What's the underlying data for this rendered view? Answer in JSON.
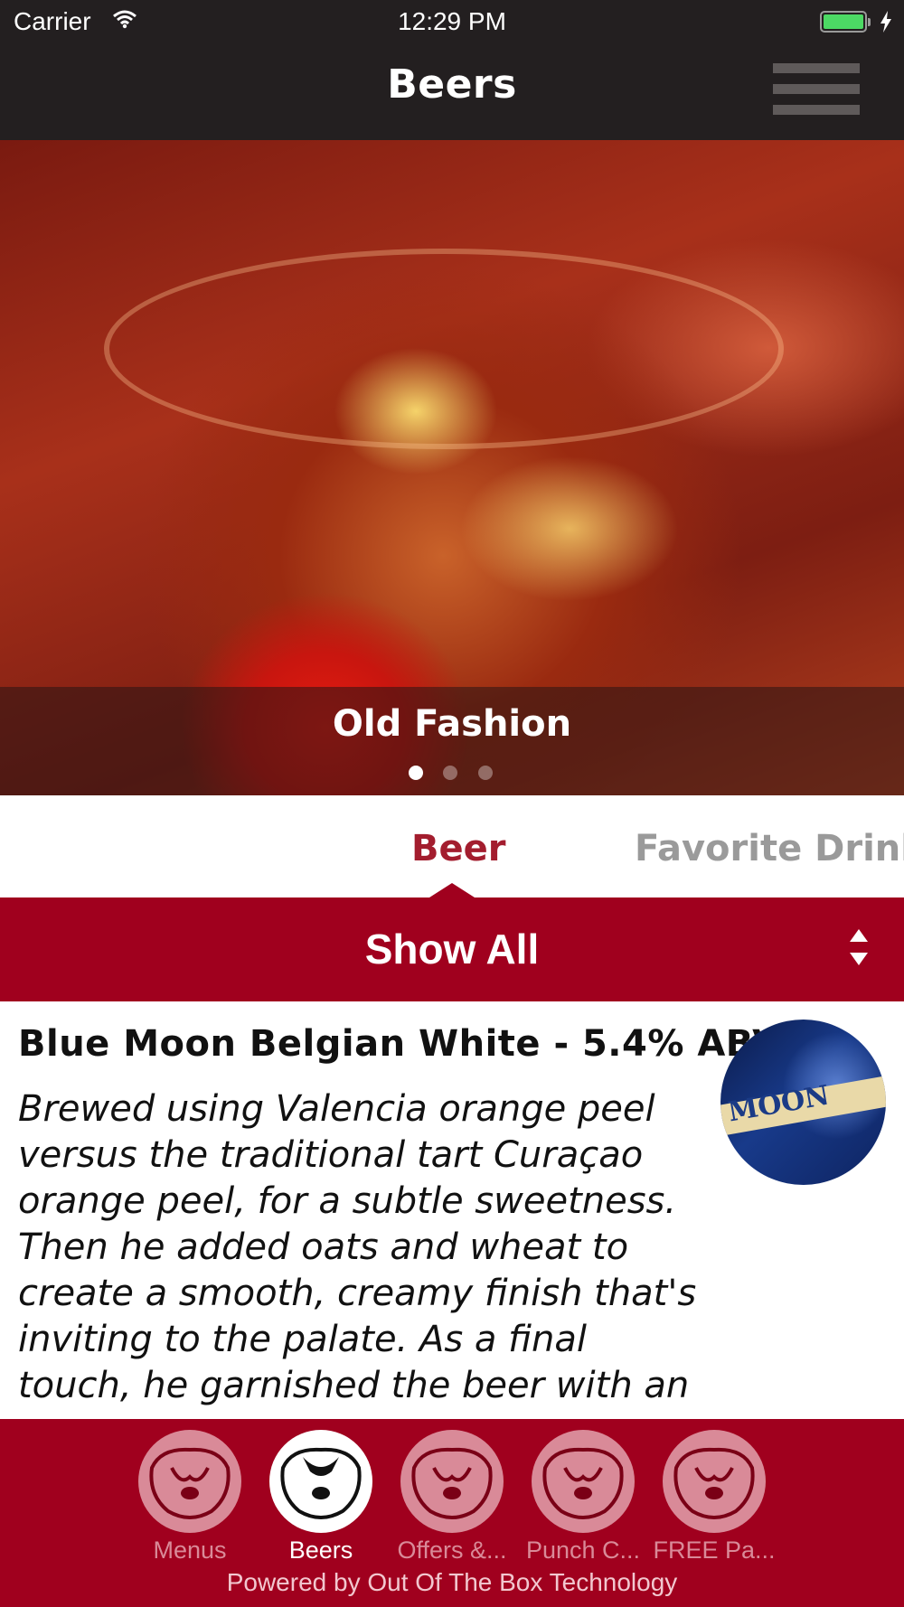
{
  "status_bar": {
    "carrier": "Carrier",
    "time": "12:29 PM",
    "battery_level": 1.0,
    "wifi_icon": "wifi-icon",
    "charging_icon": "bolt-icon"
  },
  "nav": {
    "title": "Beers",
    "menu_icon": "hamburger-icon"
  },
  "hero": {
    "caption": "Old Fashion",
    "page_count": 3,
    "current_page": 1
  },
  "tabs": [
    {
      "label": "Beer",
      "selected": true
    },
    {
      "label": "Favorite Drink",
      "selected": false
    }
  ],
  "filter": {
    "label": "Show All",
    "icon": "sort-updown-icon"
  },
  "items": [
    {
      "title": "Blue Moon Belgian White - 5.4% ABV",
      "description": "Brewed using Valencia orange peel versus the traditional tart Curaçao orange peel, for a subtle sweetness. Then he added oats and wheat to create a smooth, creamy finish that's inviting to the palate. As a final touch, he garnished the beer with an",
      "thumbnail_text": "MOON"
    }
  ],
  "tabbar": {
    "items": [
      {
        "label": "Menus",
        "active": false
      },
      {
        "label": "Beers",
        "active": true
      },
      {
        "label": "Offers &...",
        "active": false
      },
      {
        "label": "Punch C...",
        "active": false
      },
      {
        "label": "FREE Pa...",
        "active": false
      }
    ],
    "footer": "Powered by Out Of The Box Technology"
  },
  "colors": {
    "nav_bg": "#231f20",
    "accent": "#a0001e",
    "tab_selected": "#a31d2e",
    "tab_unselected": "#9a9a9a",
    "tab_icon_inactive": "#d98a98"
  }
}
